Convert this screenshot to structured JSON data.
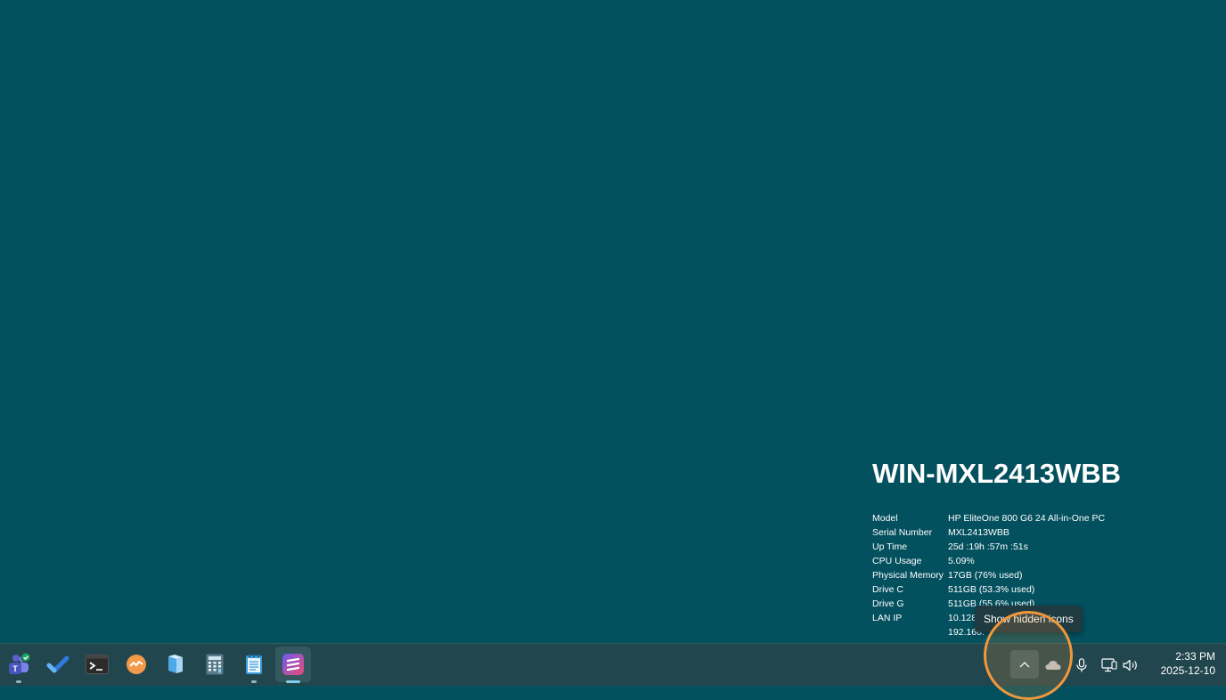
{
  "bginfo": {
    "hostname": "WIN-MXL2413WBB",
    "rows": [
      {
        "key": "Model",
        "value": "HP EliteOne 800 G6 24 All-in-One PC"
      },
      {
        "key": "Serial Number",
        "value": "MXL2413WBB"
      },
      {
        "key": "Up Time",
        "value": "25d :19h :57m :51s"
      },
      {
        "key": "CPU Usage",
        "value": "5.09%"
      },
      {
        "key": "Physical Memory",
        "value": " 17GB (76% used)"
      },
      {
        "key": "Drive C",
        "value": " 511GB (53.3% used)"
      },
      {
        "key": "Drive G",
        "value": " 511GB (55.6% used)"
      },
      {
        "key": "LAN IP",
        "value": "10.128"
      },
      {
        "key": "",
        "value": "192.168."
      }
    ]
  },
  "tooltip": {
    "text": "Show hidden icons"
  },
  "taskbar": {
    "apps": [
      {
        "name": "teams-icon",
        "color": "#5b5fc7",
        "badge": "#1ba463"
      },
      {
        "name": "todo-icon",
        "color": "#2f7be0"
      },
      {
        "name": "terminal-icon",
        "color": "#2b2b2b"
      },
      {
        "name": "app-orange-icon",
        "color": "#f2994a"
      },
      {
        "name": "file-explorer-icon",
        "color": "#4ea8e8"
      },
      {
        "name": "calculator-icon",
        "color": "#5a7a8a"
      },
      {
        "name": "notepad-icon",
        "color": "#3a9bdc"
      },
      {
        "name": "active-app-icon",
        "color": "#e94b76"
      }
    ],
    "tray": {
      "chevron": "show-hidden-icons-button",
      "icons": [
        "onedrive-icon",
        "microphone-icon",
        "network-icon",
        "volume-icon"
      ]
    },
    "clock": {
      "time": "2:33 PM",
      "date": "2025-12-10"
    }
  },
  "colors": {
    "desktop": "#03505e",
    "taskbar": "#22464e",
    "highlight": "#f0973c"
  }
}
